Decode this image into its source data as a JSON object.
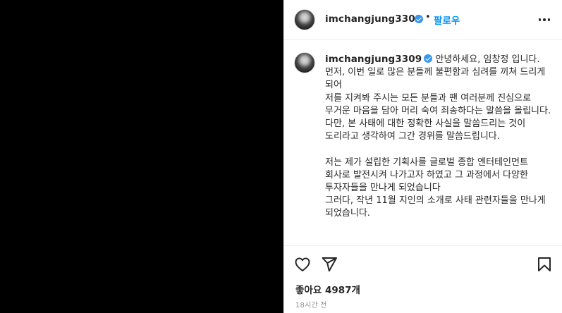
{
  "post": {
    "author": "imchangjung3309",
    "follow_label": "팔로우",
    "separator": "•",
    "caption_first": "안녕하세요, 임창정 입니다.",
    "caption_lines": [
      "먼저, 이번 일로 많은 분들께 불편함과 심려를 끼쳐 드리게 되어",
      "저를 지켜봐 주시는 모든 분들과 팬 여러분께 진심으로 무거운 마음을 담아 머리 숙여 죄송하다는 말씀을 올립니다.",
      "다만, 본 사태에 대한 정확한 사실을 말씀드리는 것이 도리라고 생각하여 그간 경위를 말씀드립니다.",
      "",
      "저는 제가 설립한 기획사를 글로벌 종합 엔터테인먼트 회사로 발전시켜 나가고자 하였고 그 과정에서 다양한 투자자들을 만나게 되었습니다",
      "그러다, 작년 11월 지인의 소개로 사태 관련자들을 만나게 되었습니다."
    ],
    "likes_text": "좋아요 4987개",
    "timestamp": "18시간 전",
    "icons": {
      "avatar": "avatar",
      "verified": "verified-badge-icon",
      "more": "more-options-icon",
      "like": "heart-icon",
      "share": "paper-plane-icon",
      "save": "bookmark-icon"
    },
    "colors": {
      "accent": "#0095f6",
      "verified": "#3897f0",
      "text": "#262626",
      "muted": "#8e8e8e",
      "media_bg": "#000000"
    }
  }
}
